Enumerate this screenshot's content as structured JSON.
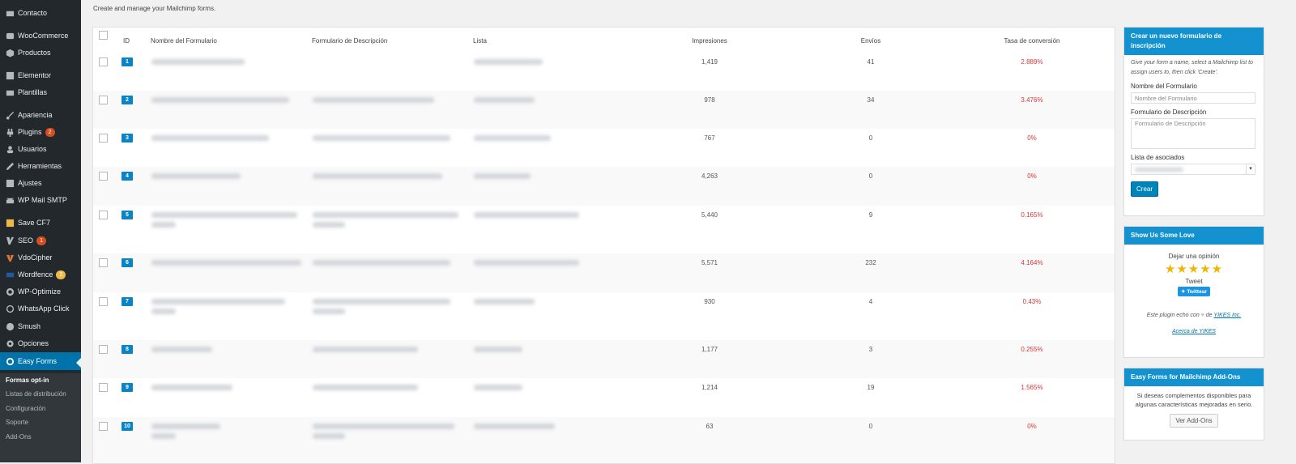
{
  "sidebar": {
    "items": [
      {
        "label": "Contacto",
        "icon": "mail-icon"
      },
      {
        "label": "WooCommerce",
        "icon": "woocommerce-icon"
      },
      {
        "label": "Productos",
        "icon": "box-icon"
      },
      {
        "label": "Elementor",
        "icon": "elementor-icon"
      },
      {
        "label": "Plantillas",
        "icon": "folder-icon"
      },
      {
        "label": "Apariencia",
        "icon": "brush-icon"
      },
      {
        "label": "Plugins",
        "icon": "plug-icon",
        "badge": "2"
      },
      {
        "label": "Usuarios",
        "icon": "user-icon"
      },
      {
        "label": "Herramientas",
        "icon": "wrench-icon"
      },
      {
        "label": "Ajustes",
        "icon": "settings-icon"
      },
      {
        "label": "WP Mail SMTP",
        "icon": "envelope-icon"
      },
      {
        "label": "Save CF7",
        "icon": "save-icon"
      },
      {
        "label": "SEO",
        "icon": "yoast-icon",
        "badge": "1"
      },
      {
        "label": "VdoCipher",
        "icon": "video-icon"
      },
      {
        "label": "Wordfence",
        "icon": "shield-icon",
        "badge": "2"
      },
      {
        "label": "WP-Optimize",
        "icon": "optimize-icon"
      },
      {
        "label": "WhatsApp Click",
        "icon": "whatsapp-icon"
      },
      {
        "label": "Smush",
        "icon": "smush-icon"
      },
      {
        "label": "Opciones",
        "icon": "gear-icon"
      },
      {
        "label": "Easy Forms",
        "icon": "easy-forms-icon"
      }
    ],
    "submenu": [
      {
        "label": "Formas opt-in",
        "current": true
      },
      {
        "label": "Listas de distribución"
      },
      {
        "label": "Configuración"
      },
      {
        "label": "Soporte"
      },
      {
        "label": "Add-Ons"
      }
    ]
  },
  "main": {
    "description": "Create and manage your Mailchimp forms.",
    "columns": {
      "id": "ID",
      "name": "Nombre del Formulario",
      "description": "Formulario de Descripción",
      "list": "Lista",
      "impressions": "Impresiones",
      "submissions": "Envíos",
      "conversion": "Tasa de conversión"
    },
    "rows": [
      {
        "id": "1",
        "impressions": "1,419",
        "submissions": "41",
        "conversion": "2.889%"
      },
      {
        "id": "2",
        "impressions": "978",
        "submissions": "34",
        "conversion": "3.476%"
      },
      {
        "id": "3",
        "impressions": "767",
        "submissions": "0",
        "conversion": "0%"
      },
      {
        "id": "4",
        "impressions": "4,263",
        "submissions": "0",
        "conversion": "0%"
      },
      {
        "id": "5",
        "impressions": "5,440",
        "submissions": "9",
        "conversion": "0.165%"
      },
      {
        "id": "6",
        "impressions": "5,571",
        "submissions": "232",
        "conversion": "4.164%"
      },
      {
        "id": "7",
        "impressions": "930",
        "submissions": "4",
        "conversion": "0.43%"
      },
      {
        "id": "8",
        "impressions": "1,177",
        "submissions": "3",
        "conversion": "0.255%"
      },
      {
        "id": "9",
        "impressions": "1,214",
        "submissions": "19",
        "conversion": "1.565%"
      },
      {
        "id": "10",
        "impressions": "63",
        "submissions": "0",
        "conversion": "0%"
      }
    ]
  },
  "widgets": {
    "create": {
      "title": "Crear un nuevo formulario de inscripción",
      "help": "Give your form a name, select a Mailchimp list to assign users to, then click 'Create'.",
      "name_label": "Nombre del Formulario",
      "name_placeholder": "Nombre del Formulario",
      "desc_label": "Formulario de Descripción",
      "desc_placeholder": "Formulario de Descripción",
      "list_label": "Lista de asociados",
      "create_button": "Crear"
    },
    "love": {
      "title": "Show Us Some Love",
      "review_label": "Dejar una opinión",
      "stars": 5,
      "tweet_label": "Tweet",
      "twitter_button": "Twittear",
      "made_by_prefix": "Este plugin echo con",
      "made_by_de": "de",
      "company_link": "YIKES Inc.",
      "about_link": "Acerca de YIKES"
    },
    "addons": {
      "title": "Easy Forms for Mailchimp Add-Ons",
      "text": "Si deseas complementos disponibles para algunas características mejoradas en serio.",
      "button": "Ver Add-Ons"
    }
  },
  "colors": {
    "sidebar_bg": "#23282d",
    "active_bg": "#0073aa",
    "accent": "#1392cf",
    "conversion": "#d63638"
  }
}
